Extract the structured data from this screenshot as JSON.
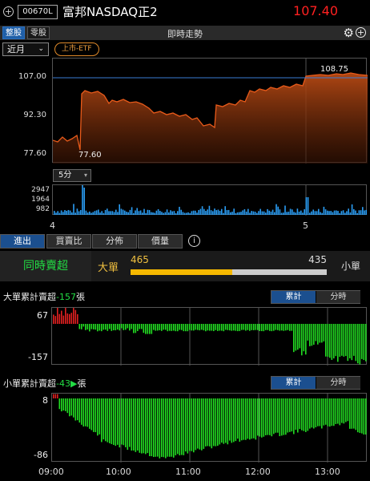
{
  "header": {
    "add_icon": "circle-plus-icon",
    "code": "00670L",
    "name": "富邦NASDAQ正2",
    "price": "107.40",
    "price_color": "#ff2020"
  },
  "section_bar": {
    "btn_whole": "整股",
    "btn_odd": "零股",
    "title": "即時走勢",
    "settings_icon": "gear-icon",
    "add_icon": "circle-plus-icon"
  },
  "controls": {
    "period": "近月",
    "tag": "上市-ETF",
    "interval": "5分"
  },
  "price_chart": {
    "y_labels": [
      "107.00",
      "92.30",
      "77.60"
    ],
    "high_label": "108.75",
    "low_label": "77.60",
    "day_labels": [
      "4",
      "5"
    ],
    "line_color": "#e85a1a"
  },
  "volume_chart": {
    "y_labels": [
      "2947",
      "1964",
      "982"
    ]
  },
  "tabs": [
    "進出",
    "買賣比",
    "分佈",
    "價量"
  ],
  "info_icon": "info-icon",
  "big_order": {
    "simul_label": "同時賣超",
    "big_label": "大單",
    "big_value": "465",
    "small_value": "435",
    "small_label": "小單",
    "ratio": 0.52
  },
  "big_cum": {
    "title_prefix": "大單累計賣超",
    "title_value": "-157",
    "title_unit": "張",
    "toggle": [
      "累計",
      "分時"
    ],
    "y_labels": [
      "67",
      "-157"
    ]
  },
  "small_cum": {
    "title_prefix": "小單累計賣超",
    "title_value": "-43",
    "title_unit": "張",
    "toggle": [
      "累計",
      "分時"
    ],
    "y_labels": [
      "8",
      "-86"
    ]
  },
  "time_labels": [
    "09:00",
    "10:00",
    "11:00",
    "12:00",
    "13:00"
  ]
}
